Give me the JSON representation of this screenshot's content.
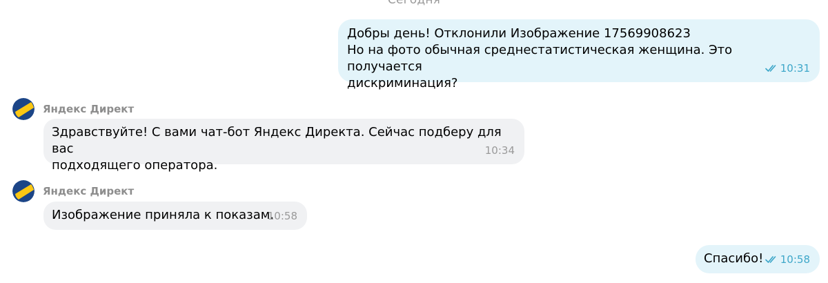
{
  "chat": {
    "date_divider": "Сегодня",
    "messages": [
      {
        "direction": "out",
        "lines": [
          "Добры день! Отклонили Изображение 17569908623",
          "Но на фото обычная среднестатистическая женщина. Это получается",
          "дискриминация?"
        ],
        "time": "10:31",
        "status": "read"
      },
      {
        "direction": "in",
        "sender": "Яндекс Директ",
        "avatar_icon": "yandex-direct-logo-icon",
        "lines": [
          "Здравствуйте! С вами чат-бот Яндекс Директа. Сейчас подберу для вас",
          "подходящего оператора."
        ],
        "time": "10:34"
      },
      {
        "direction": "in",
        "sender": "Яндекс Директ",
        "avatar_icon": "yandex-direct-logo-icon",
        "lines": [
          "Изображение приняла к показам."
        ],
        "time": "10:58"
      },
      {
        "direction": "out",
        "lines": [
          "Спасибо!"
        ],
        "time": "10:58",
        "status": "read"
      }
    ]
  },
  "colors": {
    "outgoing_bubble": "#e3f4fa",
    "incoming_bubble": "#f0f1f3",
    "read_check": "#3ea7c9",
    "avatar_yellow": "#fcc713",
    "avatar_blue": "#1c4587"
  }
}
